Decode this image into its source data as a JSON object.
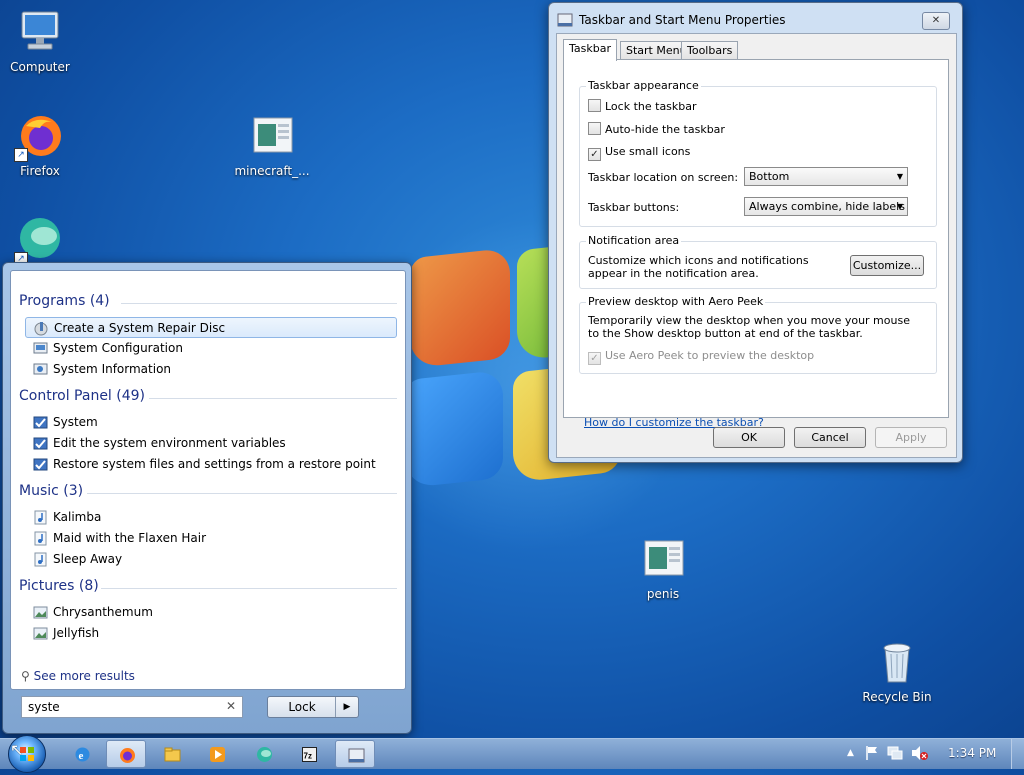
{
  "desktop": {
    "icons": [
      {
        "label": "Computer"
      },
      {
        "label": "Firefox"
      },
      {
        "label": "minecraft_..."
      },
      {
        "label": ""
      },
      {
        "label": "penis"
      },
      {
        "label": "Recycle Bin"
      }
    ]
  },
  "start_menu": {
    "categories": [
      {
        "title": "Programs (4)",
        "items": [
          "Create a System Repair Disc",
          "System Configuration",
          "System Information"
        ]
      },
      {
        "title": "Control Panel (49)",
        "items": [
          "System",
          "Edit the system environment variables",
          "Restore system files and settings from a restore point"
        ]
      },
      {
        "title": "Music (3)",
        "items": [
          "Kalimba",
          "Maid with the Flaxen Hair",
          "Sleep Away"
        ]
      },
      {
        "title": "Pictures (8)",
        "items": [
          "Chrysanthemum",
          "Jellyfish"
        ]
      }
    ],
    "see_more": "See more results",
    "search_value": "syste",
    "clear_symbol": "✕",
    "lock_label": "Lock",
    "lock_arrow": "▶"
  },
  "dialog": {
    "title": "Taskbar and Start Menu Properties",
    "close_symbol": "✕",
    "tabs": [
      "Taskbar",
      "Start Menu",
      "Toolbars"
    ],
    "appearance": {
      "title": "Taskbar appearance",
      "lock": {
        "label": "Lock the taskbar",
        "checked": false
      },
      "autohide": {
        "label": "Auto-hide the taskbar",
        "checked": false
      },
      "small_icons": {
        "label": "Use small icons",
        "checked": true
      },
      "location_label": "Taskbar location on screen:",
      "location_value": "Bottom",
      "buttons_label": "Taskbar buttons:",
      "buttons_value": "Always combine, hide labels"
    },
    "notification": {
      "title": "Notification area",
      "text": "Customize which icons and notifications appear in the notification area.",
      "button": "Customize..."
    },
    "aero_peek": {
      "title": "Preview desktop with Aero Peek",
      "text": "Temporarily view the desktop when you move your mouse to the Show desktop button at end of the taskbar.",
      "checkbox": {
        "label": "Use Aero Peek to preview the desktop",
        "checked": true,
        "disabled": true
      }
    },
    "help_link": "How do I customize the taskbar?",
    "ok": "OK",
    "cancel": "Cancel",
    "apply": "Apply"
  },
  "taskbar": {
    "clock": "1:34 PM",
    "tray_expand_symbol": "▲"
  },
  "colors": {
    "accent": "#1e3287",
    "link": "#0b4fb3"
  }
}
